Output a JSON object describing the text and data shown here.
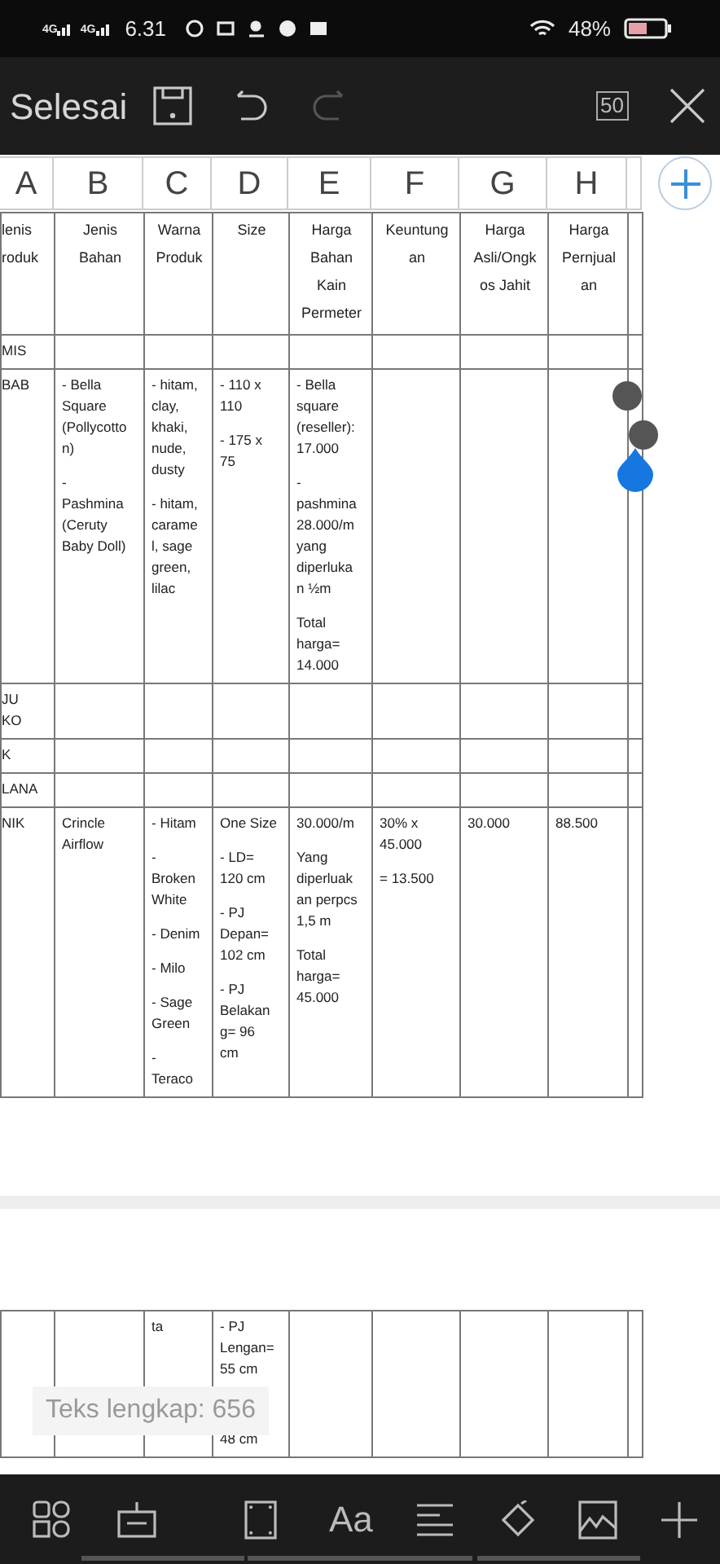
{
  "status_bar": {
    "network_labels": [
      "4G",
      "4G"
    ],
    "time": "6.31",
    "battery": "48%"
  },
  "toolbar": {
    "done": "Selesai",
    "actions": [
      {
        "kind": "save",
        "disabled": false
      },
      {
        "kind": "undo",
        "disabled": false
      },
      {
        "kind": "redo",
        "disabled": true
      }
    ],
    "zoom": "50"
  },
  "column_letters": [
    "A",
    "B",
    "C",
    "D",
    "E",
    "F",
    "G",
    "H"
  ],
  "table": {
    "header": [
      "lenis\nroduk",
      "Jenis\nBahan",
      "Warna\nProduk",
      "Size",
      "Harga\nBahan\nKain\nPermeter",
      "Keuntung\nan",
      "Harga\nAsli/Ongk\nos Jahit",
      "Harga\nPernjual\nan"
    ],
    "rows": [
      [
        [
          "MIS"
        ],
        [],
        [],
        [],
        [],
        [],
        [],
        []
      ],
      [
        [
          "BAB"
        ],
        [
          "- Bella\nSquare\n(Pollycotto\nn)",
          "-\nPashmina\n(Ceruty\nBaby Doll)"
        ],
        [
          "- hitam,\nclay,\nkhaki,\nnude,\ndusty",
          "- hitam,\ncarame\nl, sage\ngreen,\nlilac"
        ],
        [
          "- 110 x\n110",
          "- 175 x\n75"
        ],
        [
          "- Bella\nsquare\n(reseller):\n17.000",
          "-\npashmina\n28.000/m\nyang\ndiperluka\nn ½m",
          "Total\nharga=\n14.000"
        ],
        [],
        [],
        []
      ],
      [
        [
          "JU\nKO"
        ],
        [],
        [],
        [],
        [],
        [],
        [],
        []
      ],
      [
        [
          "K"
        ],
        [],
        [],
        [],
        [],
        [],
        [],
        []
      ],
      [
        [
          "LANA"
        ],
        [],
        [],
        [],
        [],
        [],
        [],
        []
      ],
      [
        [
          "NIK"
        ],
        [
          "Crincle\nAirflow"
        ],
        [
          "- Hitam",
          "-\nBroken\nWhite",
          "- Denim",
          "- Milo",
          "- Sage\nGreen",
          "-\nTeraco"
        ],
        [
          "One Size",
          "- LD=\n120 cm",
          "- PJ\nDepan=\n102 cm",
          "- PJ\nBelakan\ng= 96\ncm"
        ],
        [
          "30.000/m",
          "Yang\ndiperluak\nan perpcs\n1,5 m",
          "Total\nharga=\n45.000"
        ],
        [
          "30% x\n45.000",
          "= 13.500"
        ],
        [
          "30.000"
        ],
        [
          "88.500"
        ]
      ]
    ]
  },
  "continued_table": {
    "rows": [
      [
        [],
        [],
        [
          "ta"
        ],
        [
          "- PJ\nLengan=\n55 cm",
          "48 cm"
        ],
        [],
        [],
        [],
        []
      ]
    ]
  },
  "toast": "Teks lengkap: 656",
  "bottom_toolbar": {
    "font_button": "Aa"
  }
}
